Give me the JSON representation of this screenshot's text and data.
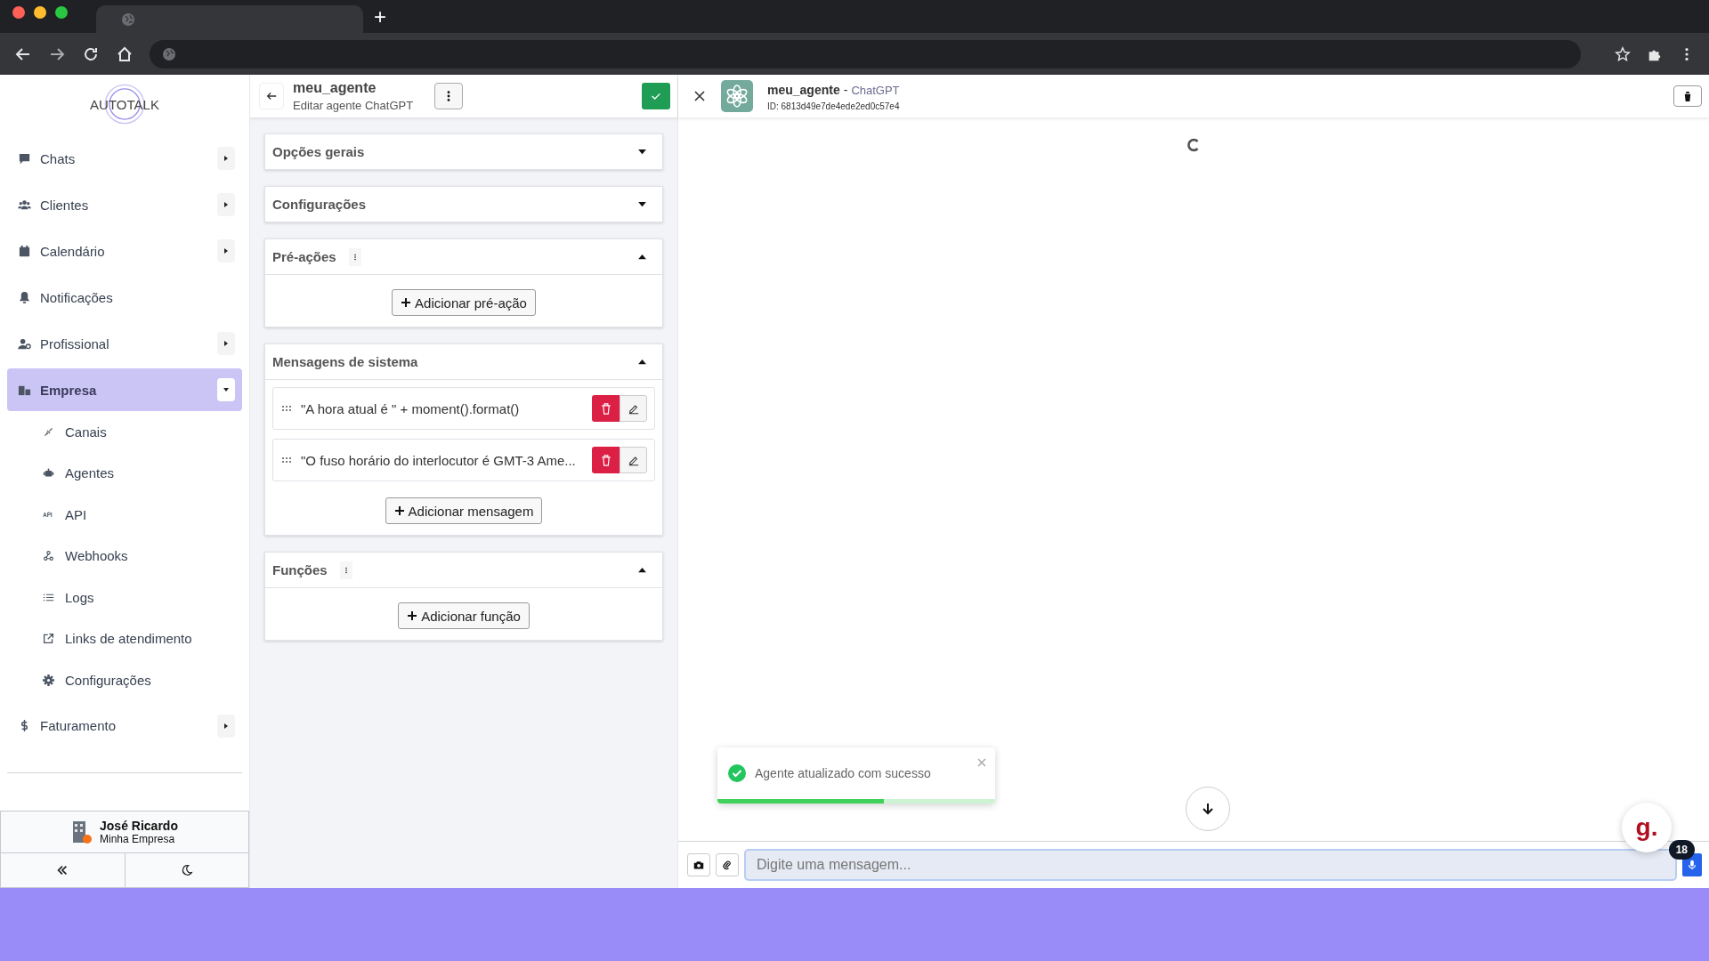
{
  "browser": {
    "new_tab": "+"
  },
  "sidebar": {
    "logo": "AUTOTALK",
    "items": [
      {
        "label": "Chats",
        "kind": "group",
        "selected": false,
        "expanded": false
      },
      {
        "label": "Clientes",
        "kind": "group",
        "selected": false,
        "expanded": false
      },
      {
        "label": "Calendário",
        "kind": "group",
        "selected": false,
        "expanded": false
      },
      {
        "label": "Notificações",
        "kind": "link",
        "selected": false
      },
      {
        "label": "Profissional",
        "kind": "group",
        "selected": false,
        "expanded": false
      },
      {
        "label": "Empresa",
        "kind": "group",
        "selected": true,
        "expanded": true,
        "children": [
          {
            "label": "Canais"
          },
          {
            "label": "Agentes"
          },
          {
            "label": "API"
          },
          {
            "label": "Webhooks"
          },
          {
            "label": "Logs"
          },
          {
            "label": "Links de atendimento"
          },
          {
            "label": "Configurações"
          }
        ]
      },
      {
        "label": "Faturamento",
        "kind": "group",
        "selected": false,
        "expanded": false
      }
    ],
    "user": {
      "name": "José Ricardo",
      "company": "Minha Empresa"
    }
  },
  "editor": {
    "title": "meu_agente",
    "subtitle": "Editar agente ChatGPT",
    "sections": [
      {
        "title": "Opções gerais",
        "expanded": false,
        "menu": false
      },
      {
        "title": "Configurações",
        "expanded": false,
        "menu": false
      },
      {
        "title": "Pré-ações",
        "expanded": true,
        "menu": true,
        "add_button": "Adicionar pré-ação"
      },
      {
        "title": "Mensagens de sistema",
        "expanded": true,
        "menu": false,
        "messages": [
          "\"A hora atual é \" + moment().format()",
          "\"O fuso horário do interlocutor é GMT-3 Ame..."
        ],
        "add_button": "Adicionar mensagem"
      },
      {
        "title": "Funções",
        "expanded": true,
        "menu": true,
        "add_button": "Adicionar função"
      }
    ]
  },
  "chat": {
    "agent_name": "meu_agente",
    "separator": "-",
    "agent_type": "ChatGPT",
    "agent_id": "ID: 6813d49e7de4ede2ed0c57e4",
    "toast": {
      "message": "Agente atualizado com sucesso",
      "level": 0.6
    },
    "placeholder": "Digite uma mensagem...",
    "badge": "18",
    "widget_logo": "g."
  }
}
